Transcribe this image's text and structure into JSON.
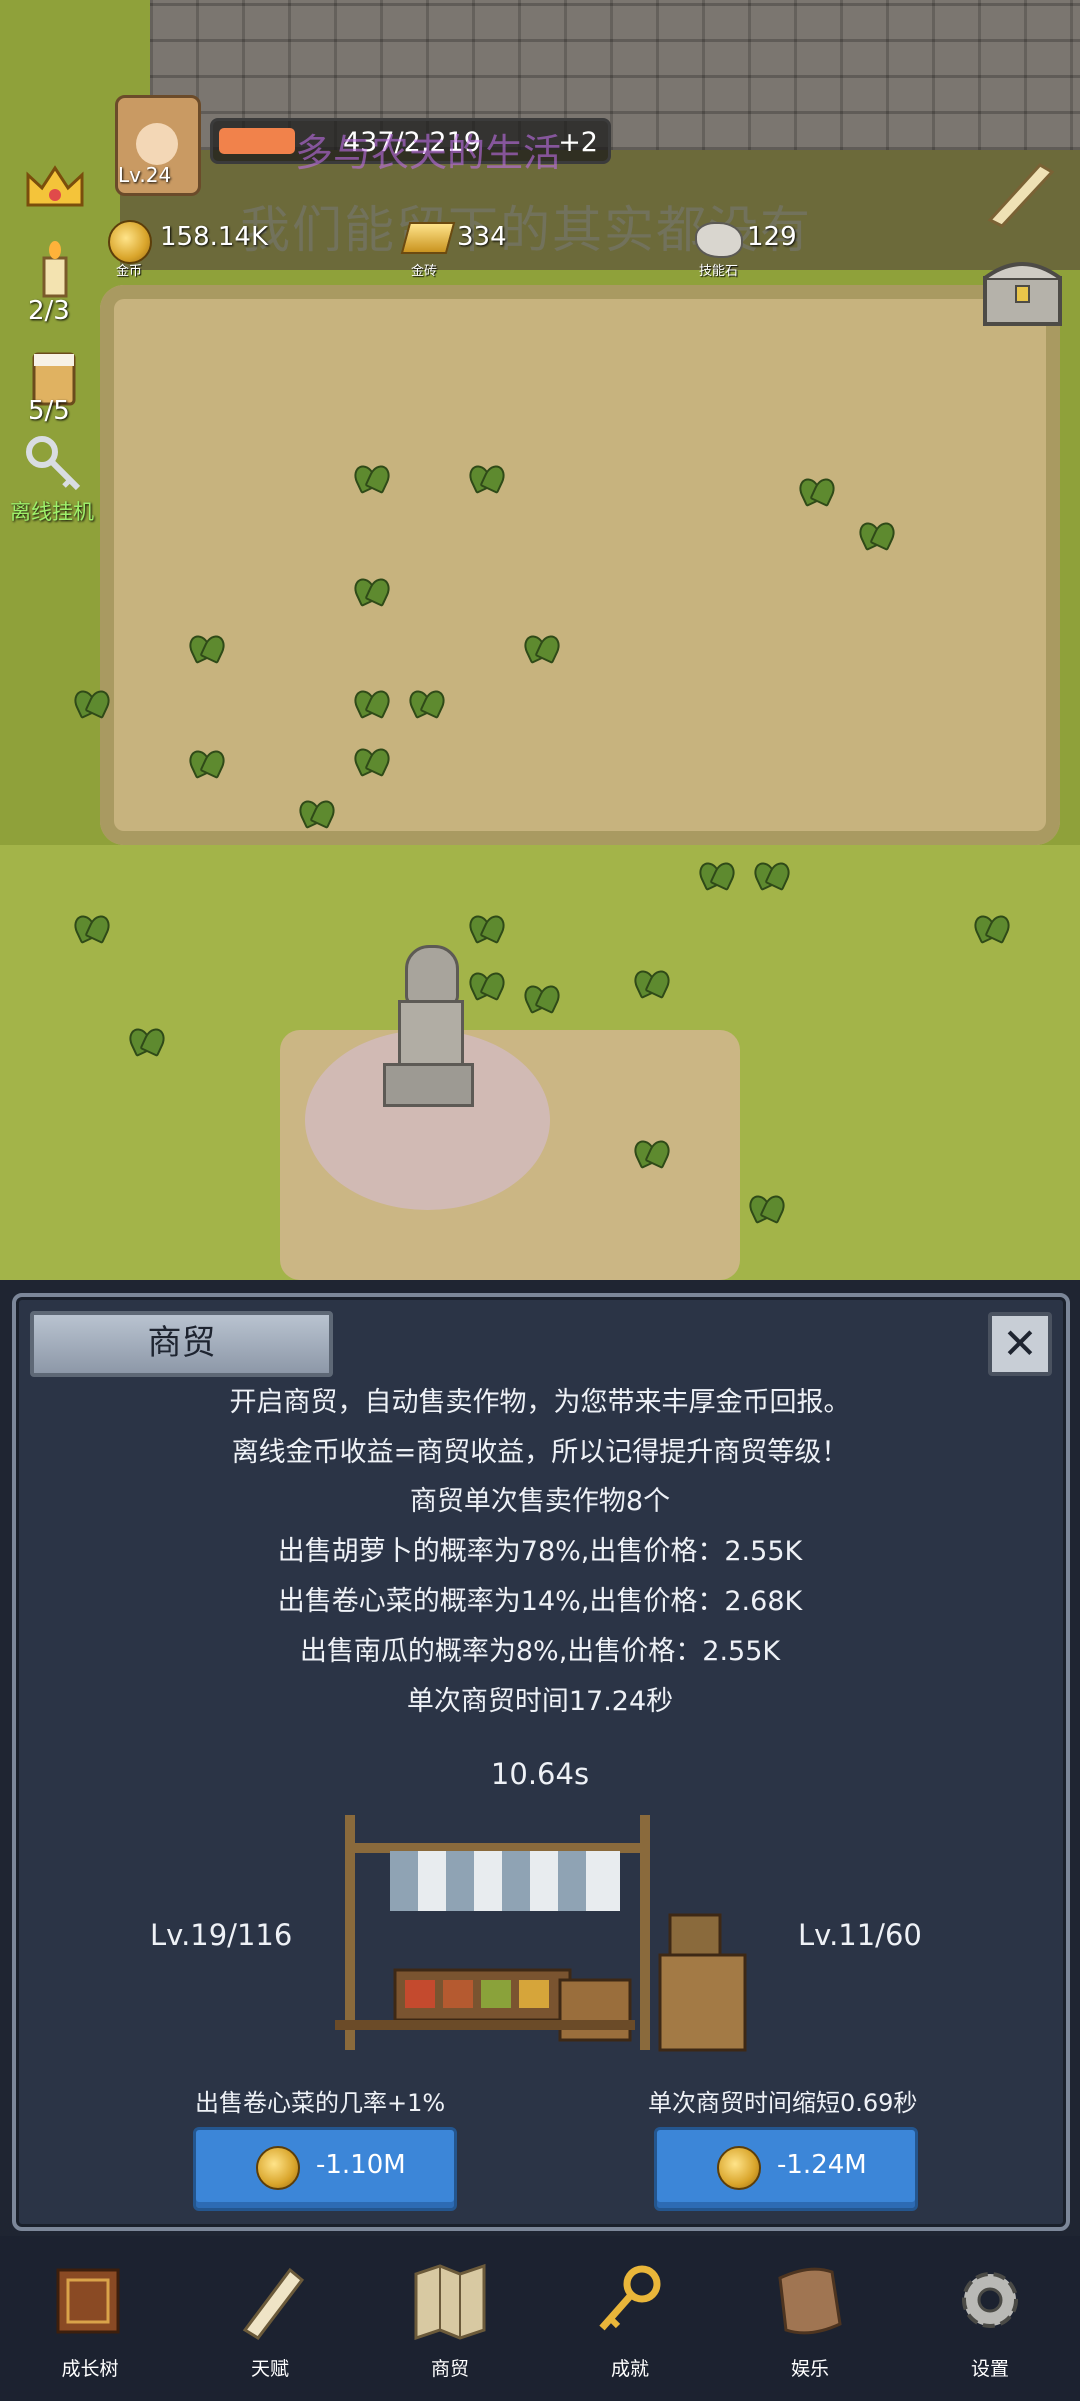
{
  "hud": {
    "level": "Lv.24",
    "xp_fraction": 0.196,
    "xp_text": "437/2,219",
    "xp_bonus": "+2",
    "watermark_line1": "多与农夫的生活",
    "watermark_line2": "我们能留下的其实都没有",
    "gold_value": "158.14K",
    "gold_label": "金币",
    "gold_bar_value": "334",
    "gold_bar_label": "金砖",
    "skill_stone_value": "129",
    "skill_stone_label": "技能石",
    "candle_count": "2/3",
    "drink_count": "5/5",
    "idle_label": "离线挂机"
  },
  "panel": {
    "title": "商贸",
    "close_icon": "x-close-icon",
    "desc": [
      "开启商贸，自动售卖作物，为您带来丰厚金币回报。",
      "离线金币收益=商贸收益，所以记得提升商贸等级！",
      "商贸单次售卖作物8个",
      "出售胡萝卜的概率为78%,出售价格：2.55K",
      "出售卷心菜的概率为14%,出售价格：2.68K",
      "出售南瓜的概率为8%,出售价格：2.55K",
      "单次商贸时间17.24秒"
    ],
    "timer": "10.64s",
    "left_level": "Lv.19/116",
    "right_level": "Lv.11/60",
    "left_upgrade_label": "出售卷心菜的几率+1%",
    "right_upgrade_label": "单次商贸时间缩短0.69秒",
    "left_cost": "-1.10M",
    "right_cost": "-1.24M"
  },
  "nav": [
    {
      "label": "成长树",
      "icon": "book-icon"
    },
    {
      "label": "天赋",
      "icon": "scroll-icon"
    },
    {
      "label": "商贸",
      "icon": "map-icon"
    },
    {
      "label": "成就",
      "icon": "key-icon"
    },
    {
      "label": "娱乐",
      "icon": "parchment-icon"
    },
    {
      "label": "设置",
      "icon": "gear-icon"
    }
  ],
  "colors": {
    "panel_bg": "#2b3446",
    "button_blue": "#3c86d8",
    "xp_orange": "#f1824b",
    "idle_green": "#9ef06a"
  }
}
